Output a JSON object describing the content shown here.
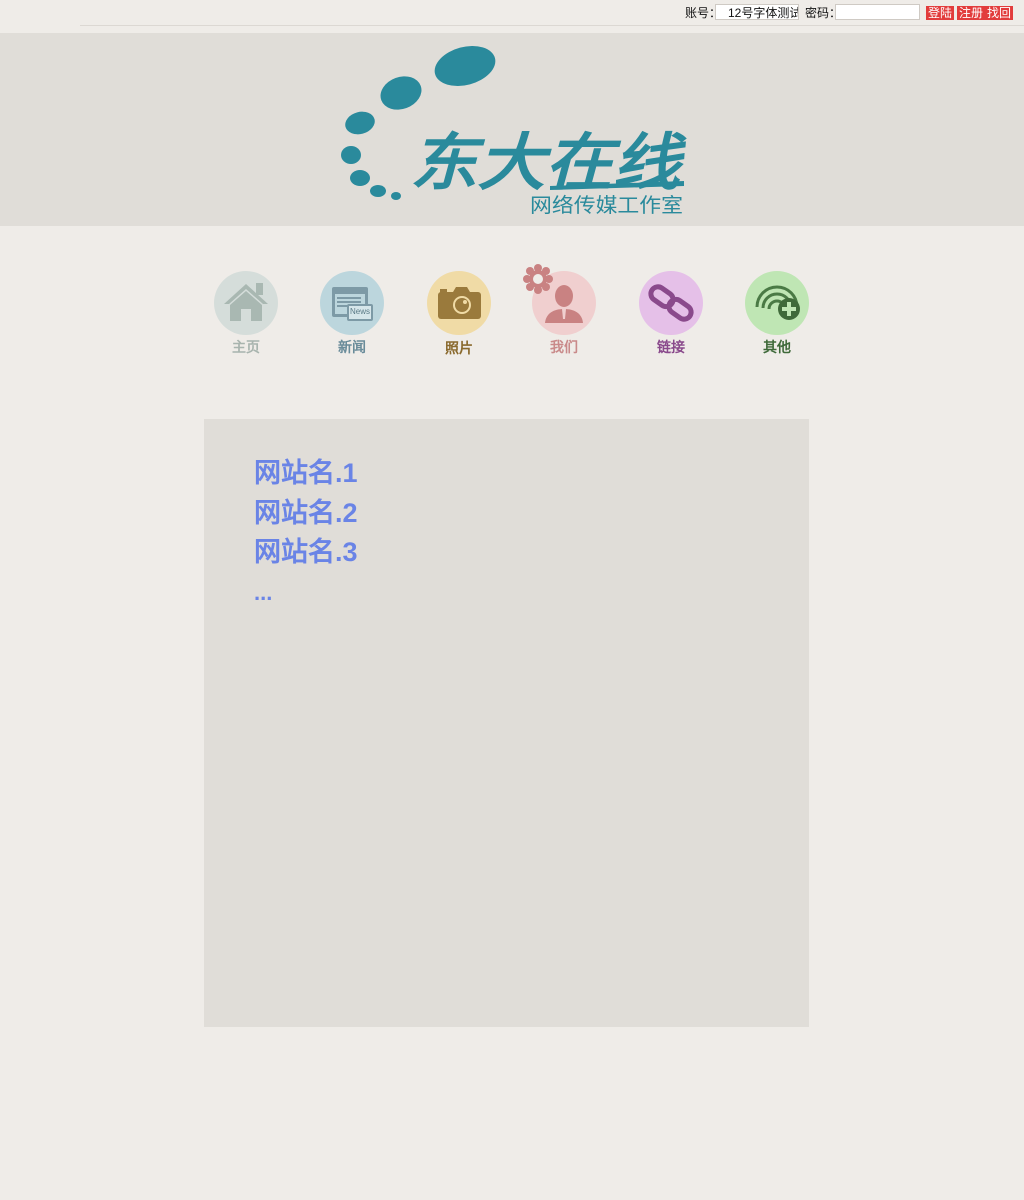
{
  "login": {
    "account_label": "账号：",
    "account_value": "12号字体测试",
    "password_label": "密码：",
    "password_value": "",
    "login_button": "登陆",
    "register_button": "注册",
    "recover_button": "找回"
  },
  "brand": {
    "title": "东大在线",
    "subtitle": "网络传媒工作室",
    "color": "#2a8a9c"
  },
  "nav": {
    "items": [
      {
        "label": "主页",
        "icon": "home-icon",
        "color": "#a8b4ae"
      },
      {
        "label": "新闻",
        "icon": "news-icon",
        "color": "#6a8c9a",
        "icon_text": "News"
      },
      {
        "label": "照片",
        "icon": "camera-icon",
        "color": "#8a6a2e"
      },
      {
        "label": "我们",
        "icon": "person-icon",
        "color": "#c98a8a"
      },
      {
        "label": "链接",
        "icon": "link-icon",
        "color": "#8a4a8c"
      },
      {
        "label": "其他",
        "icon": "add-signal-icon",
        "color": "#3f6a3a"
      }
    ]
  },
  "sites": {
    "items": [
      "网站名.1",
      "网站名.2",
      "网站名.3"
    ],
    "more": "..."
  }
}
